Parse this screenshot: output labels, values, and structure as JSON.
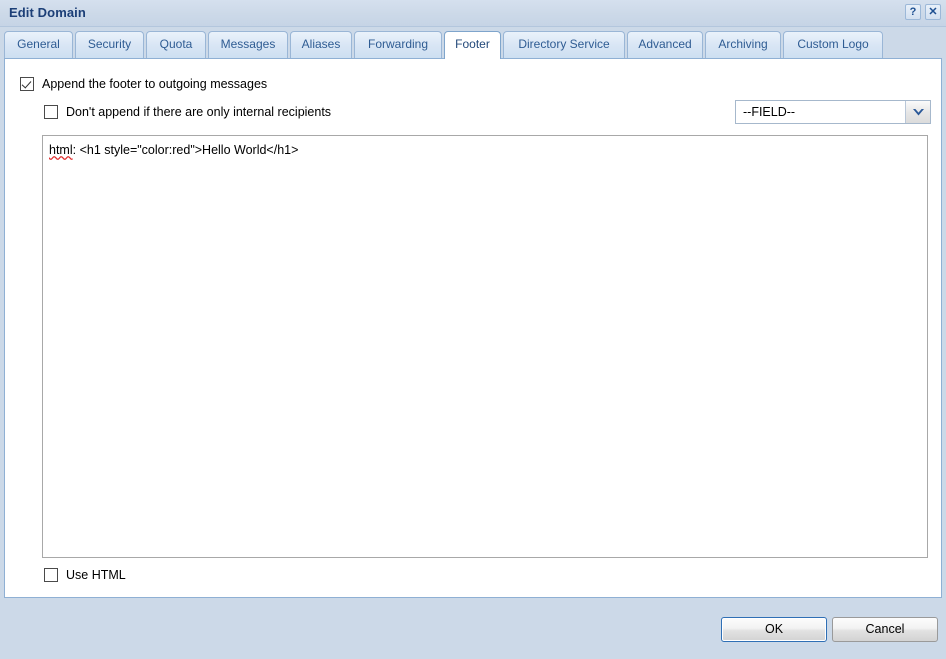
{
  "window": {
    "title": "Edit Domain",
    "help_button": "?",
    "close_button": "✕"
  },
  "tabs": [
    {
      "label": "General",
      "active": false
    },
    {
      "label": "Security",
      "active": false
    },
    {
      "label": "Quota",
      "active": false
    },
    {
      "label": "Messages",
      "active": false
    },
    {
      "label": "Aliases",
      "active": false
    },
    {
      "label": "Forwarding",
      "active": false
    },
    {
      "label": "Footer",
      "active": true
    },
    {
      "label": "Directory Service",
      "active": false
    },
    {
      "label": "Advanced",
      "active": false
    },
    {
      "label": "Archiving",
      "active": false
    },
    {
      "label": "Custom Logo",
      "active": false
    }
  ],
  "footer_panel": {
    "append_checkbox": {
      "label": "Append the footer to outgoing messages",
      "checked": true
    },
    "internal_checkbox": {
      "label": "Don't append if there are only internal recipients",
      "checked": false
    },
    "use_html_checkbox": {
      "label": "Use HTML",
      "checked": false
    },
    "field_dropdown": {
      "selected": "--FIELD--",
      "options": [
        "--FIELD--"
      ]
    },
    "text_area": {
      "misspelled_word": "html",
      "value_rest": ": <h1 style=\"color:red\">Hello World</h1>",
      "full_value": "html: <h1 style=\"color:red\">Hello World</h1>",
      "placeholder": ""
    }
  },
  "buttons": {
    "ok": "OK",
    "cancel": "Cancel"
  },
  "colors": {
    "dialog_background": "#ccd9e8",
    "title_text": "#1c3f77",
    "tab_text": "#2f5c93",
    "panel_background": "#ffffff",
    "default_button_border": "#2f6fb5",
    "spellcheck_underline": "#e03030"
  }
}
